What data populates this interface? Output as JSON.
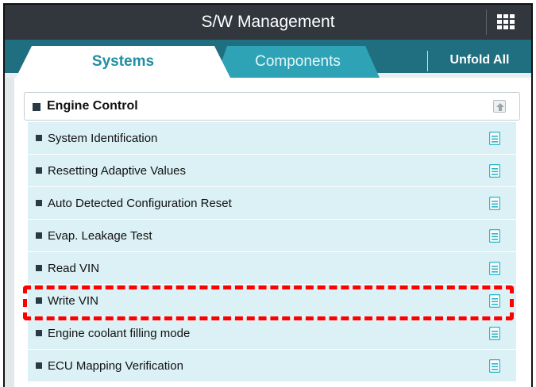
{
  "header": {
    "title": "S/W Management",
    "menu_icon": "grid-icon"
  },
  "tabs": [
    {
      "label": "Systems",
      "active": true
    },
    {
      "label": "Components",
      "active": false
    }
  ],
  "unfold_label": "Unfold All",
  "group": {
    "label": "Engine Control",
    "collapse_icon": "collapse-up-icon",
    "items": [
      {
        "label": "System Identification",
        "icon": "document-icon"
      },
      {
        "label": "Resetting Adaptive Values",
        "icon": "document-icon"
      },
      {
        "label": "Auto Detected Configuration Reset",
        "icon": "document-icon"
      },
      {
        "label": "Evap. Leakage Test",
        "icon": "document-icon"
      },
      {
        "label": "Read VIN",
        "icon": "document-icon"
      },
      {
        "label": "Write VIN",
        "icon": "document-icon",
        "highlighted": true
      },
      {
        "label": "Engine coolant filling mode",
        "icon": "document-icon"
      },
      {
        "label": "ECU Mapping Verification",
        "icon": "document-icon"
      }
    ]
  },
  "colors": {
    "titlebar": "#31373d",
    "tabbar": "#1f6f80",
    "active_tab_text": "#1f8fa3",
    "item_bg": "#dbf1f5",
    "doc_icon": "#2bb5c9",
    "highlight": "#ff0000"
  }
}
